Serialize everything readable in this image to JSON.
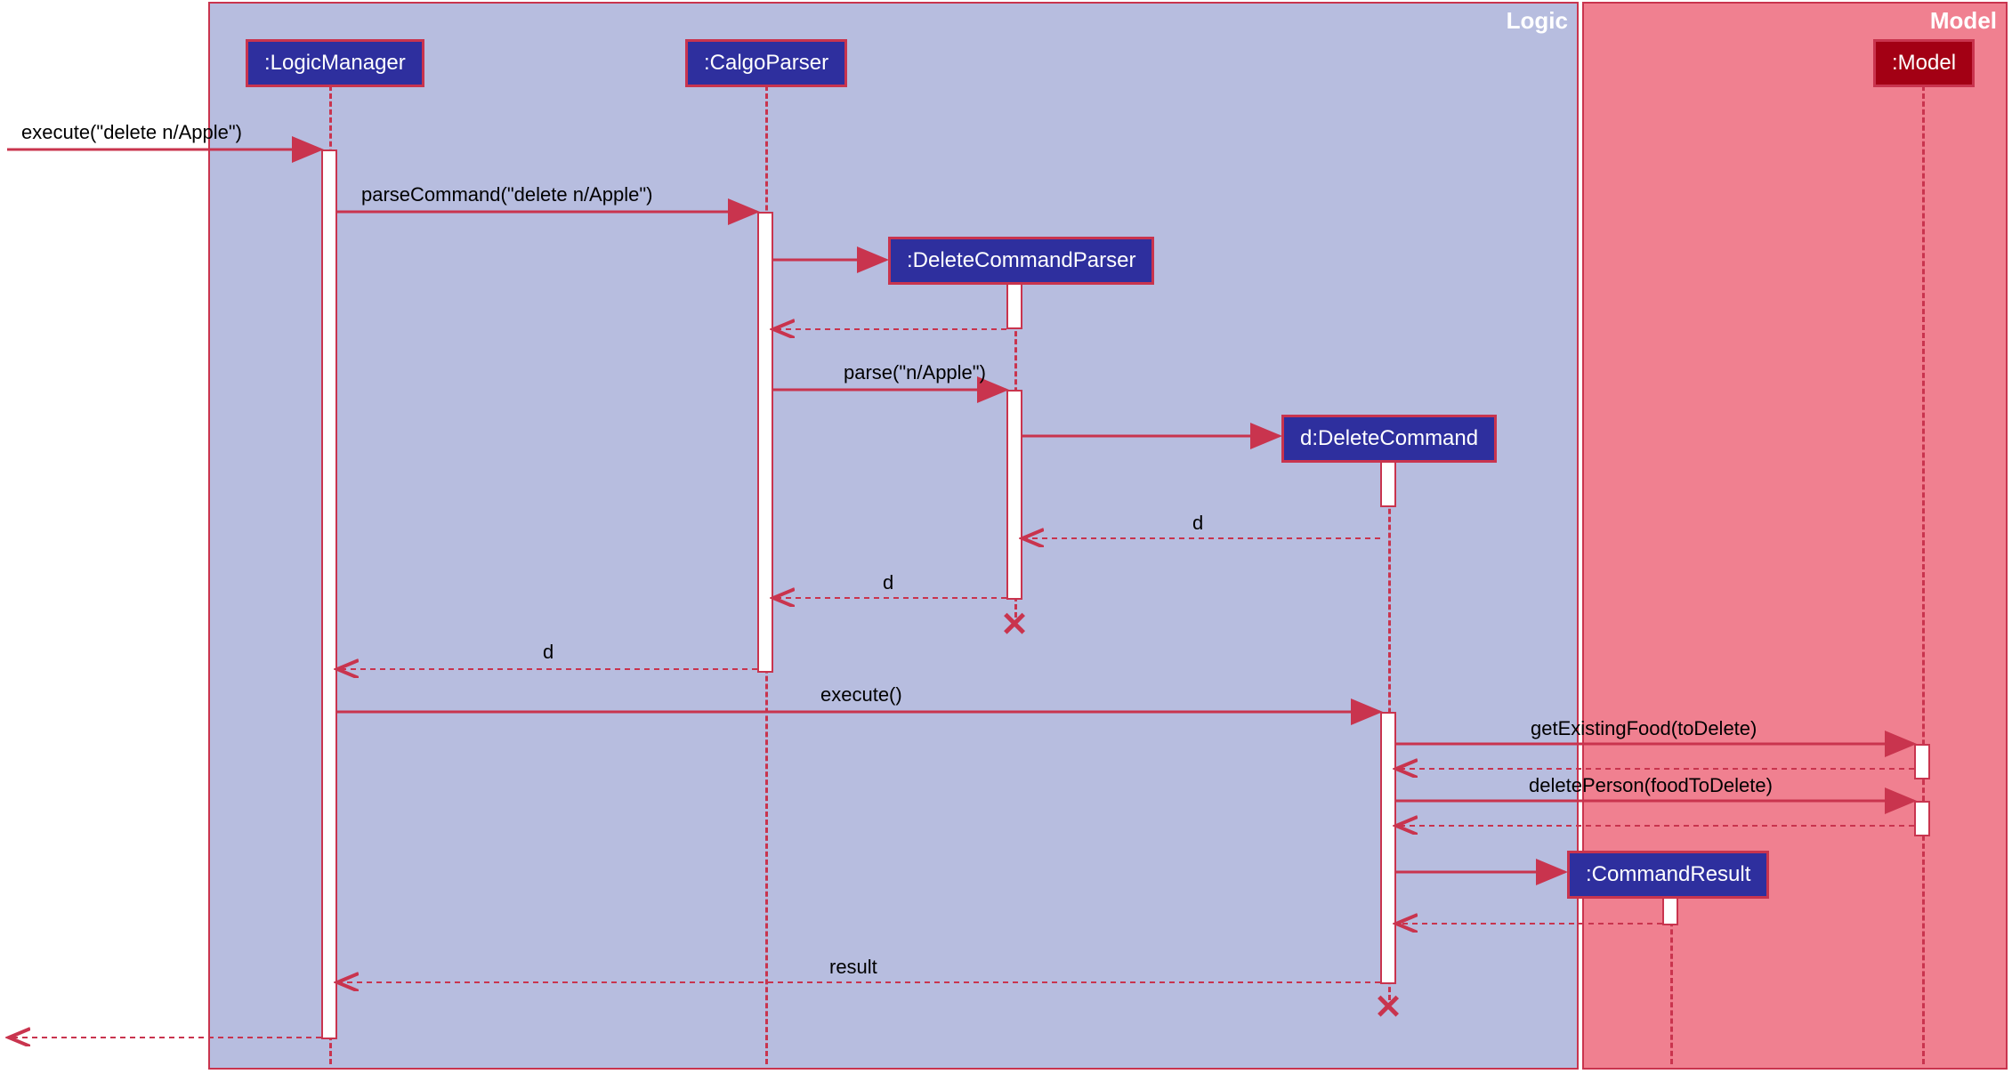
{
  "chart_data": {
    "type": "sequence-diagram",
    "frames": [
      {
        "name": "Logic"
      },
      {
        "name": "Model"
      }
    ],
    "participants": [
      {
        "id": "LogicManager",
        "label": ":LogicManager",
        "frame": "Logic"
      },
      {
        "id": "CalgoParser",
        "label": ":CalgoParser",
        "frame": "Logic"
      },
      {
        "id": "DeleteCommandParser",
        "label": ":DeleteCommandParser",
        "frame": "Logic",
        "created": true,
        "destroyed": true
      },
      {
        "id": "DeleteCommand",
        "label": "d:DeleteCommand",
        "frame": "Logic",
        "created": true,
        "destroyed": true
      },
      {
        "id": "CommandResult",
        "label": ":CommandResult",
        "frame": "Logic",
        "created": true
      },
      {
        "id": "Model",
        "label": ":Model",
        "frame": "Model"
      }
    ],
    "messages": [
      {
        "from": "external",
        "to": "LogicManager",
        "label": "execute(\"delete n/Apple\")",
        "type": "sync"
      },
      {
        "from": "LogicManager",
        "to": "CalgoParser",
        "label": "parseCommand(\"delete n/Apple\")",
        "type": "sync"
      },
      {
        "from": "CalgoParser",
        "to": "DeleteCommandParser",
        "label": "",
        "type": "create"
      },
      {
        "from": "DeleteCommandParser",
        "to": "CalgoParser",
        "label": "",
        "type": "return"
      },
      {
        "from": "CalgoParser",
        "to": "DeleteCommandParser",
        "label": "parse(\"n/Apple\")",
        "type": "sync"
      },
      {
        "from": "DeleteCommandParser",
        "to": "DeleteCommand",
        "label": "",
        "type": "create"
      },
      {
        "from": "DeleteCommand",
        "to": "DeleteCommandParser",
        "label": "d",
        "type": "return"
      },
      {
        "from": "DeleteCommandParser",
        "to": "CalgoParser",
        "label": "d",
        "type": "return"
      },
      {
        "from": "CalgoParser",
        "to": "LogicManager",
        "label": "d",
        "type": "return"
      },
      {
        "from": "LogicManager",
        "to": "DeleteCommand",
        "label": "execute()",
        "type": "sync"
      },
      {
        "from": "DeleteCommand",
        "to": "Model",
        "label": "getExistingFood(toDelete)",
        "type": "sync"
      },
      {
        "from": "Model",
        "to": "DeleteCommand",
        "label": "",
        "type": "return"
      },
      {
        "from": "DeleteCommand",
        "to": "Model",
        "label": "deletePerson(foodToDelete)",
        "type": "sync"
      },
      {
        "from": "Model",
        "to": "DeleteCommand",
        "label": "",
        "type": "return"
      },
      {
        "from": "DeleteCommand",
        "to": "CommandResult",
        "label": "",
        "type": "create"
      },
      {
        "from": "CommandResult",
        "to": "DeleteCommand",
        "label": "",
        "type": "return"
      },
      {
        "from": "DeleteCommand",
        "to": "LogicManager",
        "label": "result",
        "type": "return"
      },
      {
        "from": "LogicManager",
        "to": "external",
        "label": "",
        "type": "return"
      }
    ]
  },
  "frames": {
    "logic": "Logic",
    "model": "Model"
  },
  "participants": {
    "logicManager": ":LogicManager",
    "calgoParser": ":CalgoParser",
    "deleteCommandParser": ":DeleteCommandParser",
    "deleteCommand": "d:DeleteCommand",
    "commandResult": ":CommandResult",
    "model": ":Model"
  },
  "messages": {
    "m1": "execute(\"delete n/Apple\")",
    "m2": "parseCommand(\"delete n/Apple\")",
    "m5": "parse(\"n/Apple\")",
    "m7": "d",
    "m8": "d",
    "m9": "d",
    "m10": "execute()",
    "m11": "getExistingFood(toDelete)",
    "m13": "deletePerson(foodToDelete)",
    "m17": "result"
  }
}
